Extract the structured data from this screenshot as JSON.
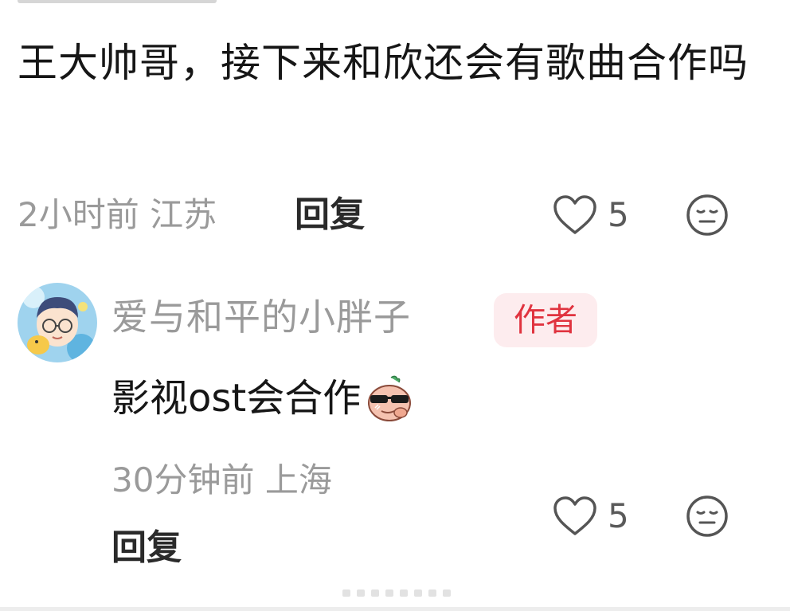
{
  "comment": {
    "text": "王大帅哥，接下来和欣还会有歌曲合作吗",
    "time": "2小时前",
    "location": "江苏",
    "reply_label": "回复",
    "like_count": "5"
  },
  "reply": {
    "username": "爱与和平的小胖子",
    "badge": "作者",
    "text": "影视ost会合作",
    "sticker_icon": "cool-bun-sticker-icon",
    "time": "30分钟前",
    "location": "上海",
    "reply_label": "回复",
    "like_count": "5"
  },
  "colors": {
    "badge_bg": "#fdecee",
    "badge_text": "#e0333f",
    "meta_text": "#9a9a9a"
  }
}
